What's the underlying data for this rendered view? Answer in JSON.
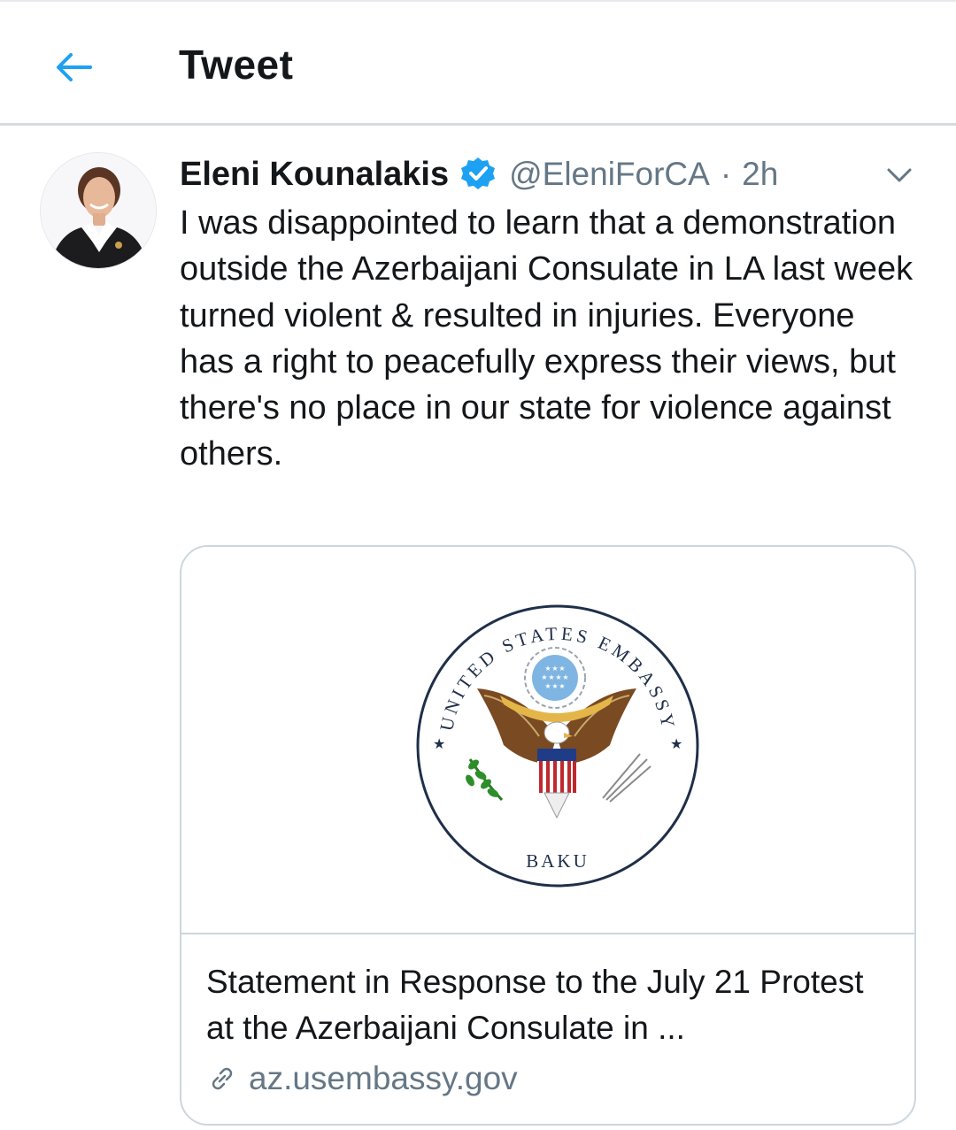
{
  "header": {
    "title": "Tweet",
    "back_icon": "arrow-left-icon",
    "accent_color": "#1da1f2"
  },
  "tweet": {
    "display_name": "Eleni Kounalakis",
    "verified_icon": "verified-badge-icon",
    "handle": "@EleniForCA",
    "separator": "·",
    "time": "2h",
    "menu_icon": "chevron-down-icon",
    "text": "I was disappointed to learn that a demonstration outside the Azerbaijani Consulate in LA last week turned violent & resulted in injuries. Everyone has a right to peacefully express their views, but there's no place in our state for violence against others."
  },
  "card": {
    "seal_top_text": "UNITED STATES EMBASSY",
    "seal_bottom_text": "BAKU",
    "title": "Statement in Response to the July 21 Protest at the Azerbaijani Consulate in ...",
    "link_icon": "link-icon",
    "domain": "az.usembassy.gov"
  }
}
